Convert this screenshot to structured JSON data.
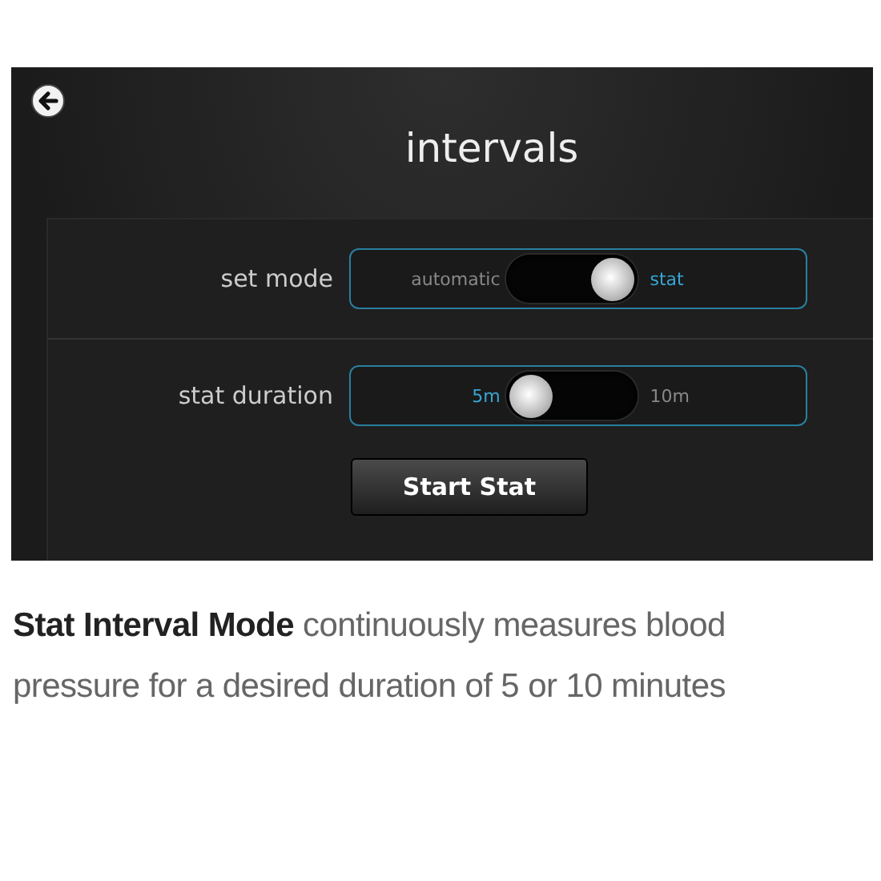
{
  "screen": {
    "title": "intervals",
    "rows": [
      {
        "label": "set mode",
        "options": [
          {
            "label": "automatic",
            "selected": false
          },
          {
            "label": "stat",
            "selected": true
          }
        ]
      },
      {
        "label": "stat duration",
        "options": [
          {
            "label": "5m",
            "selected": true
          },
          {
            "label": "10m",
            "selected": false
          }
        ]
      }
    ],
    "button": "Start Stat"
  },
  "caption": "**Stat Interval Mode** continuously measures blood pressure for a desired duration of 5 or 10 minutes"
}
